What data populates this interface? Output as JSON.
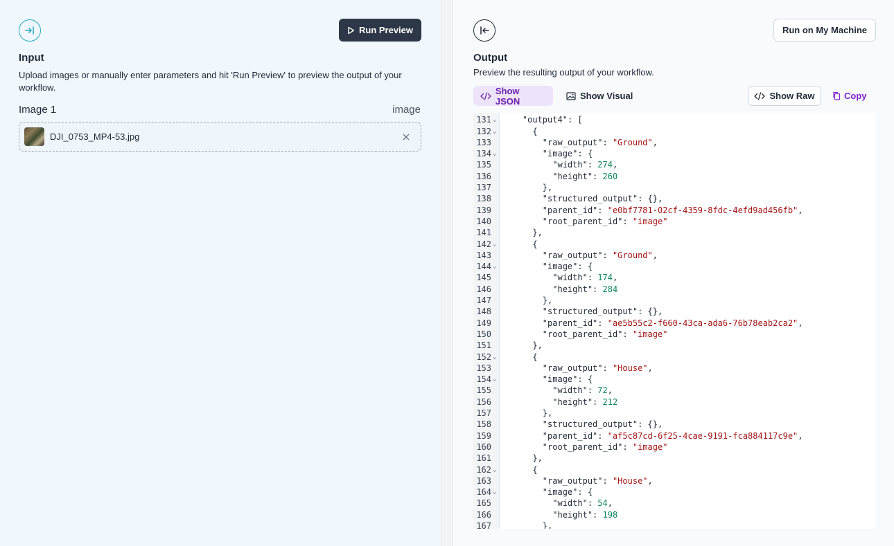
{
  "input": {
    "title": "Input",
    "description": "Upload images or manually enter parameters and hit 'Run Preview' to preview the output of your workflow.",
    "run_preview_label": "Run Preview",
    "image_label": "Image 1",
    "image_type": "image",
    "file_name": "DJI_0753_MP4-53.jpg"
  },
  "output": {
    "title": "Output",
    "description": "Preview the resulting output of your workflow.",
    "run_machine_label": "Run on My Machine",
    "tabs": [
      "Show JSON",
      "Show Visual"
    ],
    "show_raw_label": "Show Raw",
    "copy_label": "Copy"
  },
  "code": {
    "lines": [
      {
        "n": "",
        "t": "      },",
        "fold": false
      },
      {
        "n": "131",
        "t": "    \"output4\": [",
        "fold": true
      },
      {
        "n": "132",
        "t": "      {",
        "fold": true
      },
      {
        "n": "133",
        "t": "        \"raw_output\": \"Ground\",",
        "fold": false
      },
      {
        "n": "134",
        "t": "        \"image\": {",
        "fold": true
      },
      {
        "n": "135",
        "t": "          \"width\": 274,",
        "fold": false
      },
      {
        "n": "136",
        "t": "          \"height\": 260",
        "fold": false
      },
      {
        "n": "137",
        "t": "        },",
        "fold": false
      },
      {
        "n": "138",
        "t": "        \"structured_output\": {},",
        "fold": false
      },
      {
        "n": "139",
        "t": "        \"parent_id\": \"e0bf7781-02cf-4359-8fdc-4efd9ad456fb\",",
        "fold": false
      },
      {
        "n": "140",
        "t": "        \"root_parent_id\": \"image\"",
        "fold": false
      },
      {
        "n": "141",
        "t": "      },",
        "fold": false
      },
      {
        "n": "142",
        "t": "      {",
        "fold": true
      },
      {
        "n": "143",
        "t": "        \"raw_output\": \"Ground\",",
        "fold": false
      },
      {
        "n": "144",
        "t": "        \"image\": {",
        "fold": true
      },
      {
        "n": "145",
        "t": "          \"width\": 174,",
        "fold": false
      },
      {
        "n": "146",
        "t": "          \"height\": 284",
        "fold": false
      },
      {
        "n": "147",
        "t": "        },",
        "fold": false
      },
      {
        "n": "148",
        "t": "        \"structured_output\": {},",
        "fold": false
      },
      {
        "n": "149",
        "t": "        \"parent_id\": \"ae5b55c2-f660-43ca-ada6-76b78eab2ca2\",",
        "fold": false
      },
      {
        "n": "150",
        "t": "        \"root_parent_id\": \"image\"",
        "fold": false
      },
      {
        "n": "151",
        "t": "      },",
        "fold": false
      },
      {
        "n": "152",
        "t": "      {",
        "fold": true
      },
      {
        "n": "153",
        "t": "        \"raw_output\": \"House\",",
        "fold": false
      },
      {
        "n": "154",
        "t": "        \"image\": {",
        "fold": true
      },
      {
        "n": "155",
        "t": "          \"width\": 72,",
        "fold": false
      },
      {
        "n": "156",
        "t": "          \"height\": 212",
        "fold": false
      },
      {
        "n": "157",
        "t": "        },",
        "fold": false
      },
      {
        "n": "158",
        "t": "        \"structured_output\": {},",
        "fold": false
      },
      {
        "n": "159",
        "t": "        \"parent_id\": \"af5c87cd-6f25-4cae-9191-fca884117c9e\",",
        "fold": false
      },
      {
        "n": "160",
        "t": "        \"root_parent_id\": \"image\"",
        "fold": false
      },
      {
        "n": "161",
        "t": "      },",
        "fold": false
      },
      {
        "n": "162",
        "t": "      {",
        "fold": true
      },
      {
        "n": "163",
        "t": "        \"raw_output\": \"House\",",
        "fold": false
      },
      {
        "n": "164",
        "t": "        \"image\": {",
        "fold": true
      },
      {
        "n": "165",
        "t": "          \"width\": 54,",
        "fold": false
      },
      {
        "n": "166",
        "t": "          \"height\": 198",
        "fold": false
      },
      {
        "n": "167",
        "t": "        },",
        "fold": false
      }
    ]
  },
  "colors": {
    "accent_purple": "#7e22ce",
    "teal": "#22a7c2",
    "string": "#a31515",
    "number": "#098658"
  }
}
